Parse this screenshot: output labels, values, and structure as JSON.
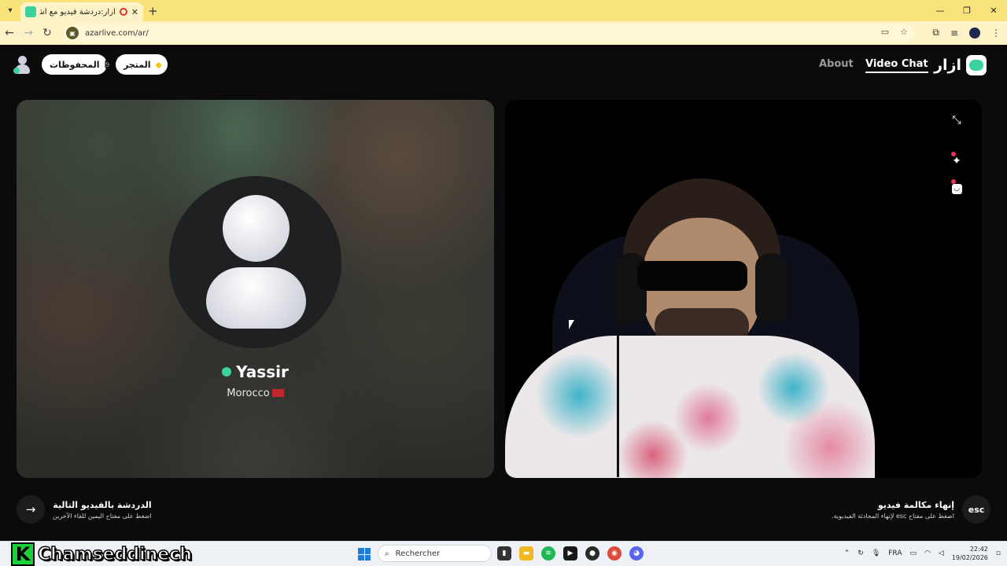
{
  "browser": {
    "tab_title": "أزار:دردشة فيديو مع أشخاص",
    "url": "azarlive.com/ar/"
  },
  "site": {
    "brand": "ازار",
    "nav": {
      "video_chat": "Video Chat",
      "about": "About"
    },
    "buttons": {
      "saved": "المحفوظات",
      "store": "المتجر"
    }
  },
  "partner": {
    "name": "Yassir",
    "country": "Morocco"
  },
  "hints": {
    "next": {
      "title": "الدردشة بالفيديو التالية",
      "subtitle": "اضغط على مفتاح اليمين للقاء الآخرين",
      "icon": "arrow-right-icon"
    },
    "end": {
      "title": "إنهاء مكالمة فيديو",
      "subtitle": "اضغط على مفتاح esc لإنهاء المحادثة الفيديوية.",
      "key": "esc"
    }
  },
  "overlay": {
    "letter": "K",
    "name": "Chamseddinech"
  },
  "taskbar": {
    "search_placeholder": "Rechercher",
    "language": "FRA",
    "time": "22:42",
    "date": "19/02/2026"
  },
  "colors": {
    "accent": "#3ad29f",
    "tabbar": "#f8e27a",
    "notification": "#e8315b"
  }
}
